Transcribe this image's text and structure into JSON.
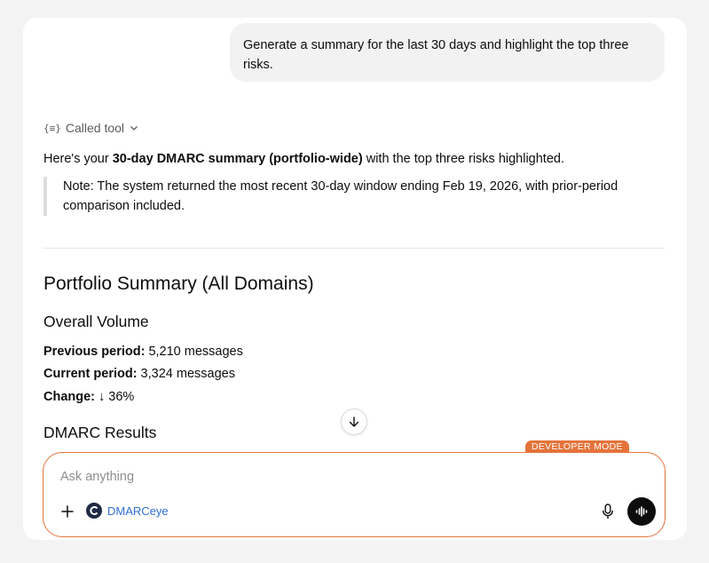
{
  "chat": {
    "user_message": "Generate a summary for the last 30 days and highlight the top three risks.",
    "called_tool_label": "Called tool",
    "intro_prefix": "Here's your ",
    "intro_bold": "30-day DMARC summary (portfolio-wide)",
    "intro_suffix": " with the top three risks highlighted.",
    "note": "Note: The system returned the most recent 30-day window ending Feb 19, 2026, with prior-period comparison included."
  },
  "summary": {
    "title": "Portfolio Summary (All Domains)",
    "volume_heading": "Overall Volume",
    "previous_label": "Previous period:",
    "previous_value": " 5,210 messages",
    "current_label": "Current period:",
    "current_value": " 3,324 messages",
    "change_label": "Change:",
    "change_value": " ↓ 36%",
    "dmarc_heading": "DMARC Results"
  },
  "composer": {
    "badge": "DEVELOPER MODE",
    "placeholder": "Ask anything",
    "app_name": "DMARCeye"
  },
  "colors": {
    "accent": "#e4733a",
    "link": "#2f6fd6"
  }
}
